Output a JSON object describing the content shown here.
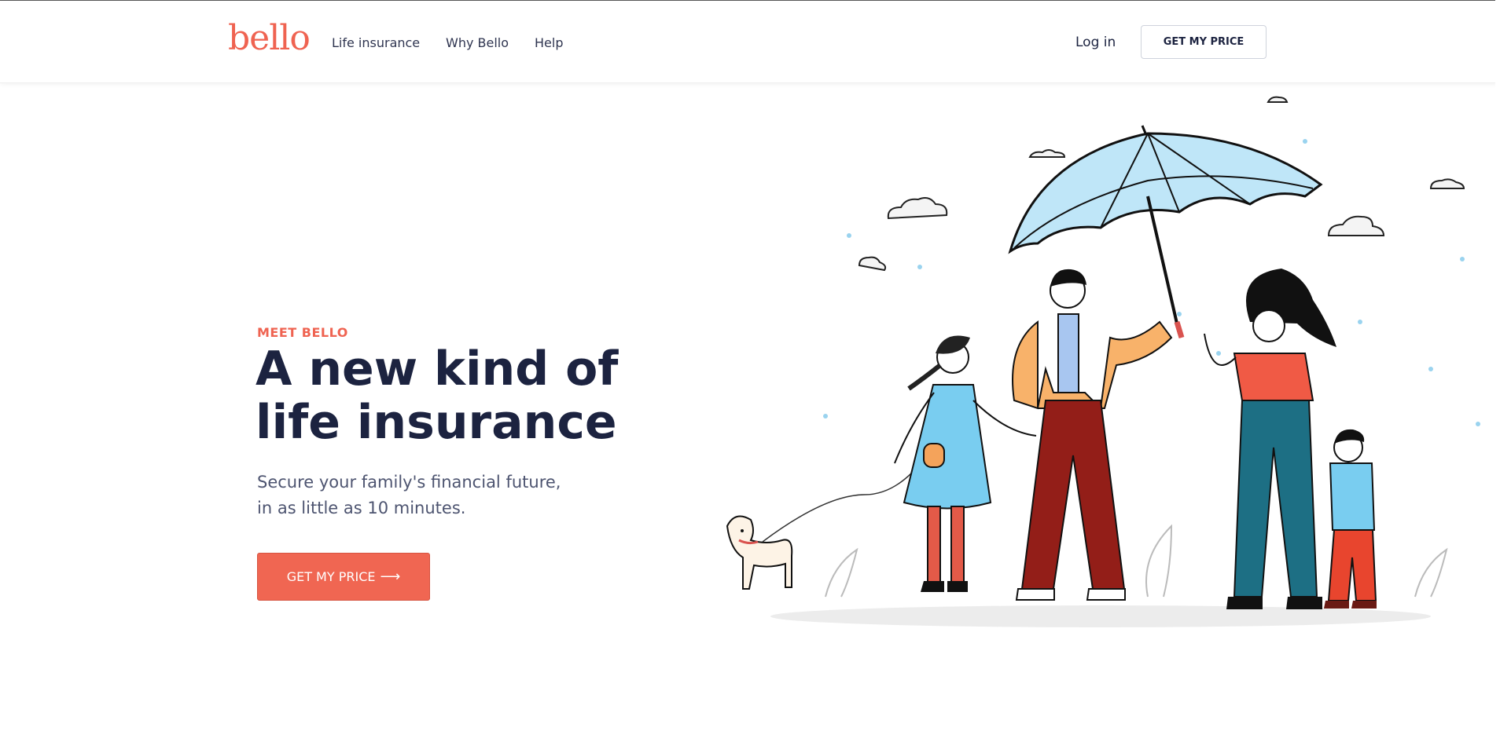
{
  "header": {
    "logo": "bello",
    "nav": [
      {
        "label": "Life insurance"
      },
      {
        "label": "Why Bello"
      },
      {
        "label": "Help"
      }
    ],
    "login_label": "Log in",
    "cta_label": "GET MY PRICE"
  },
  "hero": {
    "eyebrow": "MEET BELLO",
    "title_line1": "A new kind of",
    "title_line2": "life insurance",
    "subtitle_line1": "Secure your family's financial future,",
    "subtitle_line2": "in as little as 10 minutes.",
    "cta_label": "GET MY PRICE",
    "cta_icon": "arrow-right-icon"
  },
  "colors": {
    "brand": "#ef6351",
    "text_dark": "#1c2340",
    "text_muted": "#4d5470"
  }
}
